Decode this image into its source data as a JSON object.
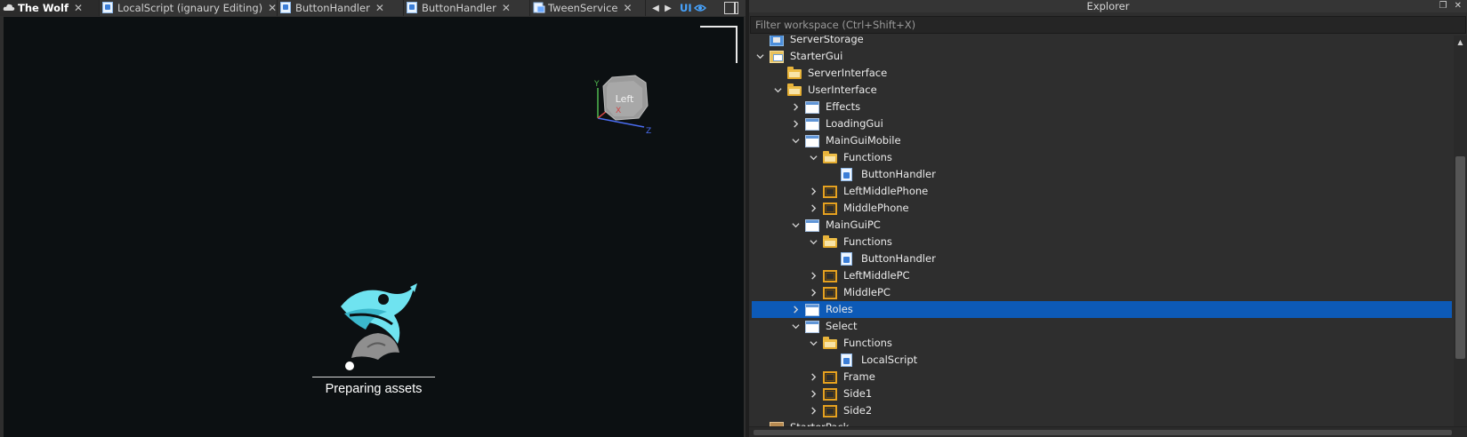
{
  "tabs": [
    {
      "label": "The Wolf",
      "icon": "cloud-icon",
      "active": true
    },
    {
      "label": "LocalScript (ignaury Editing)",
      "icon": "local-script-icon",
      "active": false
    },
    {
      "label": "ButtonHandler",
      "icon": "local-script-icon",
      "active": false
    },
    {
      "label": "ButtonHandler",
      "icon": "local-script-icon",
      "active": false
    },
    {
      "label": "TweenService",
      "icon": "module-script-icon",
      "active": false
    }
  ],
  "tab_close_glyph": "✕",
  "ui_toggle_label": "UI",
  "viewport": {
    "view_cube_face": "Left",
    "axis_y": "Y",
    "axis_x": "X",
    "axis_z": "Z",
    "loading_text": "Preparing assets"
  },
  "explorer": {
    "title": "Explorer",
    "filter_placeholder": "Filter workspace (Ctrl+Shift+X)",
    "selected_color": "#0d5ab7",
    "items": [
      {
        "label": "ServerStorage",
        "depth": 0,
        "icon": "server-storage-icon",
        "expand": "none"
      },
      {
        "label": "StarterGui",
        "depth": 0,
        "icon": "starter-gui-icon",
        "expand": "open"
      },
      {
        "label": "ServerInterface",
        "depth": 1,
        "icon": "folder-icon",
        "expand": "none"
      },
      {
        "label": "UserInterface",
        "depth": 1,
        "icon": "folder-icon",
        "expand": "open"
      },
      {
        "label": "Effects",
        "depth": 2,
        "icon": "screen-gui-icon",
        "expand": "closed"
      },
      {
        "label": "LoadingGui",
        "depth": 2,
        "icon": "screen-gui-icon",
        "expand": "closed"
      },
      {
        "label": "MainGuiMobile",
        "depth": 2,
        "icon": "screen-gui-icon",
        "expand": "open"
      },
      {
        "label": "Functions",
        "depth": 3,
        "icon": "folder-icon",
        "expand": "open"
      },
      {
        "label": "ButtonHandler",
        "depth": 4,
        "icon": "local-script-icon",
        "expand": "none"
      },
      {
        "label": "LeftMiddlePhone",
        "depth": 3,
        "icon": "frame-icon",
        "expand": "closed"
      },
      {
        "label": "MiddlePhone",
        "depth": 3,
        "icon": "frame-icon",
        "expand": "closed"
      },
      {
        "label": "MainGuiPC",
        "depth": 2,
        "icon": "screen-gui-icon",
        "expand": "open"
      },
      {
        "label": "Functions",
        "depth": 3,
        "icon": "folder-icon",
        "expand": "open"
      },
      {
        "label": "ButtonHandler",
        "depth": 4,
        "icon": "local-script-icon",
        "expand": "none"
      },
      {
        "label": "LeftMiddlePC",
        "depth": 3,
        "icon": "frame-icon",
        "expand": "closed"
      },
      {
        "label": "MiddlePC",
        "depth": 3,
        "icon": "frame-icon",
        "expand": "closed"
      },
      {
        "label": "Roles",
        "depth": 2,
        "icon": "screen-gui-icon",
        "expand": "closed",
        "selected": true
      },
      {
        "label": "Select",
        "depth": 2,
        "icon": "screen-gui-icon",
        "expand": "open"
      },
      {
        "label": "Functions",
        "depth": 3,
        "icon": "folder-icon",
        "expand": "open"
      },
      {
        "label": "LocalScript",
        "depth": 4,
        "icon": "local-script-icon",
        "expand": "none"
      },
      {
        "label": "Frame",
        "depth": 3,
        "icon": "frame-icon",
        "expand": "closed"
      },
      {
        "label": "Side1",
        "depth": 3,
        "icon": "frame-icon",
        "expand": "closed"
      },
      {
        "label": "Side2",
        "depth": 3,
        "icon": "frame-icon",
        "expand": "closed"
      },
      {
        "label": "StarterPack",
        "depth": 0,
        "icon": "starter-pack-icon",
        "expand": "none"
      }
    ]
  }
}
